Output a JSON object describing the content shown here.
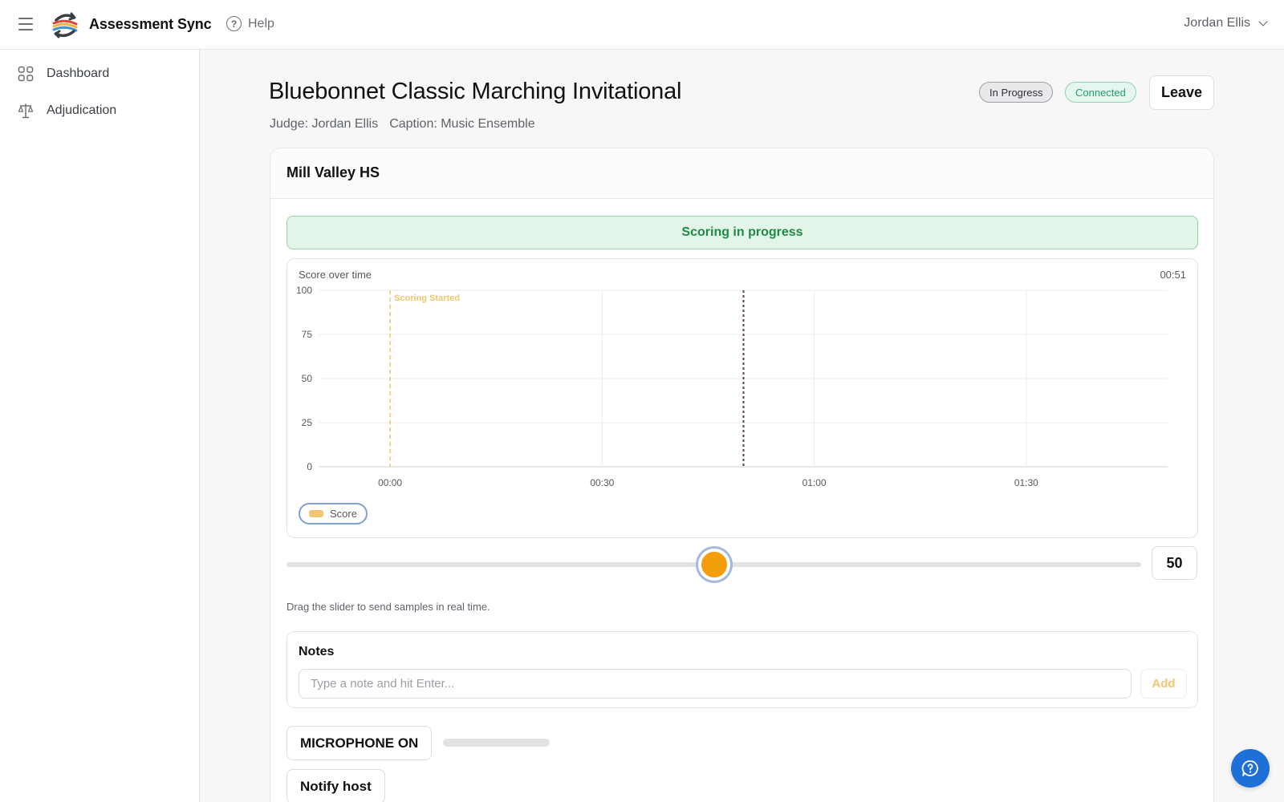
{
  "app": {
    "brand": "Assessment Sync",
    "help_label": "Help",
    "user_name": "Jordan Ellis"
  },
  "sidebar": {
    "items": [
      {
        "label": "Dashboard",
        "icon": "grid-icon"
      },
      {
        "label": "Adjudication",
        "icon": "scales-icon"
      }
    ]
  },
  "event": {
    "title": "Bluebonnet Classic Marching Invitational",
    "judge": "Judge: Jordan Ellis",
    "caption": "Caption: Music Ensemble",
    "badges": {
      "status": "In Progress",
      "connection": "Connected"
    },
    "leave_label": "Leave"
  },
  "performer": {
    "name": "Mill Valley HS",
    "status_banner": "Scoring in progress"
  },
  "chart": {
    "title": "Score over time",
    "elapsed": "00:51",
    "legend": "Score",
    "start_marker_label": "Scoring Started"
  },
  "chart_data": {
    "type": "line",
    "title": "Score over time",
    "xlabel": "",
    "ylabel": "",
    "x_ticks": [
      "00:00",
      "00:30",
      "01:00",
      "01:30"
    ],
    "y_ticks": [
      0,
      25,
      50,
      75,
      100
    ],
    "xlim_seconds": [
      -10,
      110
    ],
    "ylim": [
      0,
      100
    ],
    "series": [
      {
        "name": "Score",
        "color": "#f2c56f",
        "values": []
      }
    ],
    "markers": [
      {
        "label": "Scoring Started",
        "x_seconds": 0,
        "color": "#f2c56f",
        "style": "dashed"
      },
      {
        "label": "",
        "x_seconds": 50,
        "color": "#5a4636",
        "style": "dotted"
      }
    ],
    "grid": true,
    "legend_position": "bottom-left"
  },
  "slider": {
    "value": 50,
    "value_label": "50",
    "min": 0,
    "max": 100,
    "help": "Drag the slider to send samples in real time."
  },
  "notes": {
    "label": "Notes",
    "placeholder": "Type a note and hit Enter...",
    "add_label": "Add"
  },
  "controls": {
    "microphone_label": "MICROPHONE ON",
    "mic_level": 0,
    "notify_label": "Notify host"
  },
  "colors": {
    "accent": "#f59e0b",
    "success": "#1f8a45",
    "primary": "#1f6fd8"
  }
}
